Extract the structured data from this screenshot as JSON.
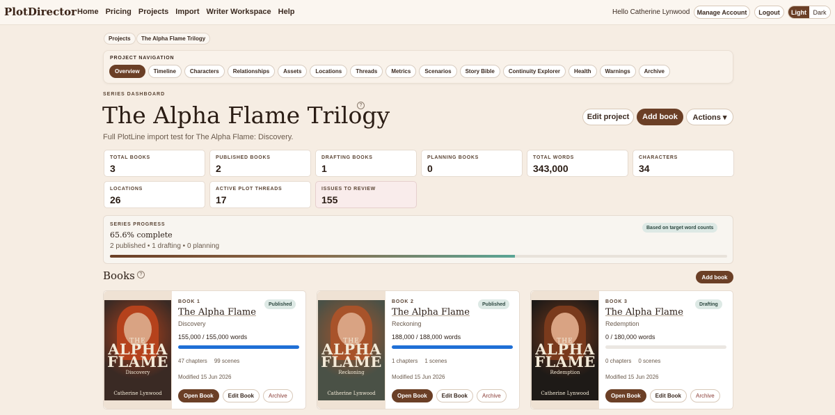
{
  "header": {
    "logo": "PlotDirector",
    "nav": [
      "Home",
      "Pricing",
      "Projects",
      "Import",
      "Writer Workspace",
      "Help"
    ],
    "greeting": "Hello Catherine Lynwood",
    "manage_account": "Manage Account",
    "logout": "Logout",
    "theme_light": "Light",
    "theme_dark": "Dark"
  },
  "breadcrumb": [
    "Projects",
    "The Alpha Flame Trilogy"
  ],
  "project_nav": {
    "label": "PROJECT NAVIGATION",
    "tabs": [
      "Overview",
      "Timeline",
      "Characters",
      "Relationships",
      "Assets",
      "Locations",
      "Threads",
      "Metrics",
      "Scenarios",
      "Story Bible",
      "Continuity Explorer",
      "Health",
      "Warnings",
      "Archive"
    ],
    "active": "Overview"
  },
  "dashboard": {
    "eyebrow": "SERIES DASHBOARD",
    "title": "The Alpha Flame Trilogy",
    "help": "?",
    "subtitle": "Full PlotLine import test for The Alpha Flame: Discovery.",
    "edit_project": "Edit project",
    "add_book": "Add book",
    "actions": "Actions ▾"
  },
  "stats": [
    {
      "label": "TOTAL BOOKS",
      "value": "3"
    },
    {
      "label": "PUBLISHED BOOKS",
      "value": "2"
    },
    {
      "label": "DRAFTING BOOKS",
      "value": "1"
    },
    {
      "label": "PLANNING BOOKS",
      "value": "0"
    },
    {
      "label": "TOTAL WORDS",
      "value": "343,000"
    },
    {
      "label": "CHARACTERS",
      "value": "34"
    },
    {
      "label": "LOCATIONS",
      "value": "26"
    },
    {
      "label": "ACTIVE PLOT THREADS",
      "value": "17"
    },
    {
      "label": "ISSUES TO REVIEW",
      "value": "155"
    }
  ],
  "progress": {
    "label": "SERIES PROGRESS",
    "percent_text": "65.6% complete",
    "summary": "2 published • 1 drafting • 0 planning",
    "badge": "Based on target word counts",
    "fraction": 0.656
  },
  "books_section": {
    "heading": "Books",
    "help": "?",
    "add_book": "Add book"
  },
  "books": [
    {
      "number": "BOOK 1",
      "title": "The Alpha Flame",
      "subtitle": "Discovery",
      "status": "Published",
      "words": "155,000 / 155,000 words",
      "progress": 1.0,
      "chapters": "47 chapters",
      "scenes": "99 scenes",
      "modified": "Modified 15 Jun 2026",
      "cover": {
        "top": "THE",
        "main": "ALPHA FLAME",
        "sub": "Discovery",
        "author": "Catherine Lynwood",
        "tone": "#3a2a24",
        "hair": "#b5421c"
      },
      "open": "Open Book",
      "edit": "Edit Book",
      "archive": "Archive"
    },
    {
      "number": "BOOK 2",
      "title": "The Alpha Flame",
      "subtitle": "Reckoning",
      "status": "Published",
      "words": "188,000 / 188,000 words",
      "progress": 1.0,
      "chapters": "1 chapters",
      "scenes": "1 scenes",
      "modified": "Modified 15 Jun 2026",
      "cover": {
        "top": "THE",
        "main": "ALPHA FLAME",
        "sub": "Reckoning",
        "author": "Catherine Lynwood",
        "tone": "#4a5146",
        "hair": "#a8532a"
      },
      "open": "Open Book",
      "edit": "Edit Book",
      "archive": "Archive"
    },
    {
      "number": "BOOK 3",
      "title": "The Alpha Flame",
      "subtitle": "Redemption",
      "status": "Drafting",
      "words": "0 / 180,000 words",
      "progress": 0.0,
      "chapters": "0 chapters",
      "scenes": "0 scenes",
      "modified": "Modified 15 Jun 2026",
      "cover": {
        "top": "THE",
        "main": "ALPHA FLAME",
        "sub": "Redemption",
        "author": "Catherine Lynwood",
        "tone": "#1e1a17",
        "hair": "#7a3a1c"
      },
      "open": "Open Book",
      "edit": "Edit Book",
      "archive": "Archive"
    }
  ]
}
